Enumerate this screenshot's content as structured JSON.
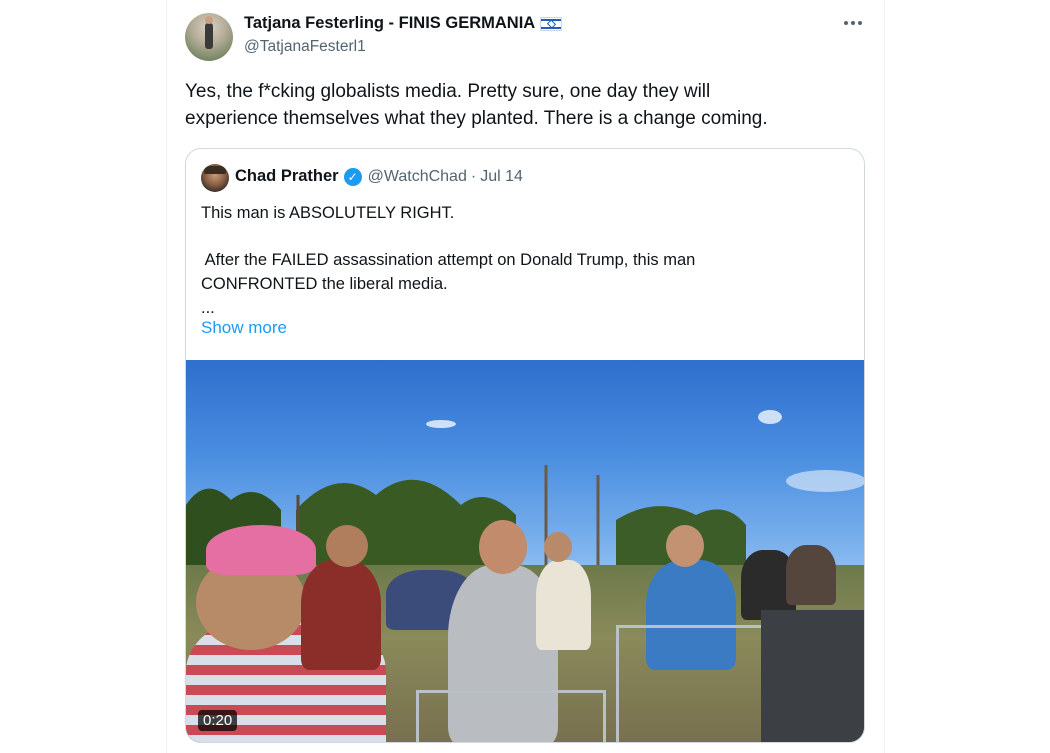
{
  "tweet": {
    "author_name": "Tatjana Festerling - FINIS GERMANIA",
    "author_flag_icon": "israel-flag-icon",
    "author_handle": "@TatjanaFesterl1",
    "text_lines": [
      "Yes, the f*cking globalists media. Pretty sure, one day they will",
      "experience themselves what they planted. There is a change coming."
    ]
  },
  "quoted_tweet": {
    "author_name": "Chad Prather",
    "verified_icon": "verified-badge-icon",
    "handle": "@WatchChad",
    "separator": "·",
    "date": "Jul 14",
    "lines": [
      "This man is ABSOLUTELY RIGHT.",
      " After the FAILED assassination attempt on Donald Trump, this man",
      "CONFRONTED the liberal media.",
      "..."
    ],
    "show_more": "Show more",
    "video": {
      "duration": "0:20"
    }
  },
  "colors": {
    "accent": "#1d9bf0",
    "secondary_text": "#536471",
    "border": "#cfd9de"
  }
}
